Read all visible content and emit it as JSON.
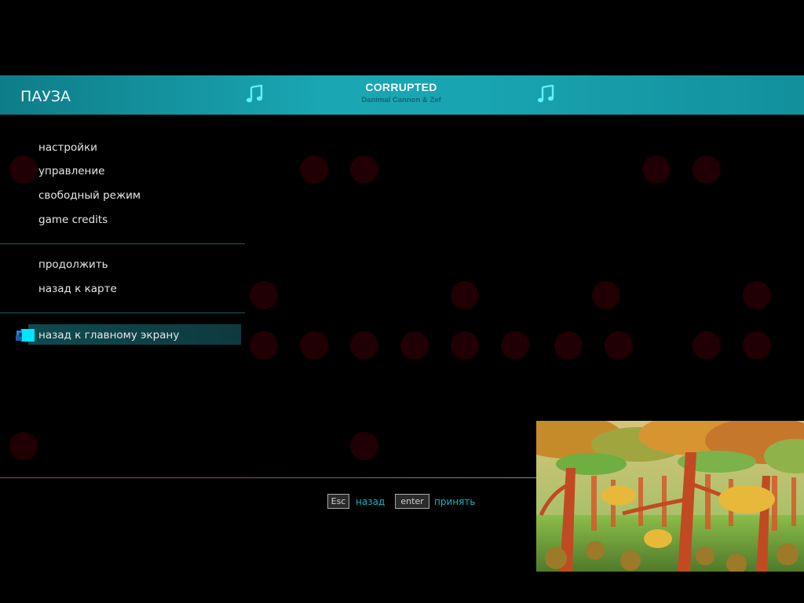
{
  "header": {
    "title": "ПАУЗА",
    "song_title": "CORRUPTED",
    "song_artist": "Danimal Cannon & Zef",
    "left_icon": "music-note-icon",
    "right_icon": "music-note-icon"
  },
  "menu": {
    "group1": [
      "настройки",
      "управление",
      "свободный режим",
      "game credits"
    ],
    "group2": [
      "продолжить",
      "назад к карте"
    ],
    "group3": [
      "назад к главному экрану"
    ],
    "selected": "назад к главному экрану"
  },
  "footer": {
    "back_key": "Esc",
    "back_label": "назад",
    "accept_key": "enter",
    "accept_label": "принять"
  },
  "colors": {
    "accent": "#1aa6b3",
    "background": "#000000",
    "hint_text": "#16b3c1"
  }
}
